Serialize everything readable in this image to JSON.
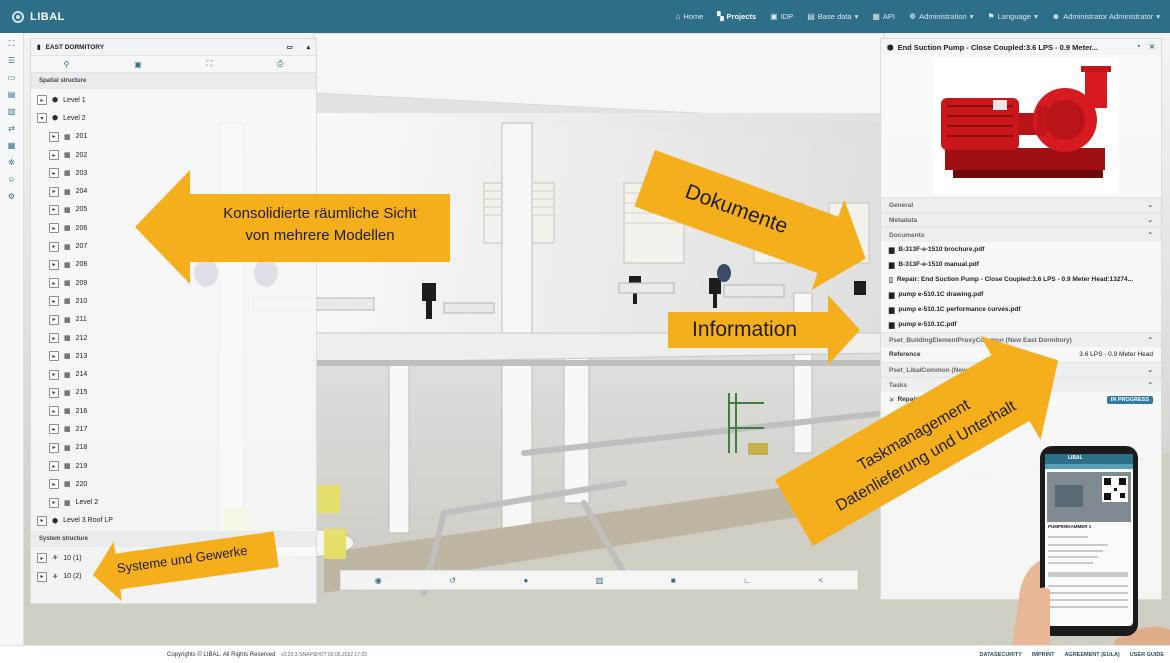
{
  "app": {
    "brand": "LIBAL",
    "nav": [
      {
        "icon": "home-icon",
        "glyph": "⌂",
        "label": "Home",
        "caret": false
      },
      {
        "icon": "projects-icon",
        "glyph": "▚",
        "label": "Projects",
        "caret": false,
        "active": true
      },
      {
        "icon": "idp-icon",
        "glyph": "▣",
        "label": "IDP",
        "caret": false
      },
      {
        "icon": "database-icon",
        "glyph": "▤",
        "label": "Base data",
        "caret": true
      },
      {
        "icon": "api-icon",
        "glyph": "▦",
        "label": "API",
        "caret": false
      },
      {
        "icon": "admin-icon",
        "glyph": "☸",
        "label": "Administration",
        "caret": true
      },
      {
        "icon": "flag-icon",
        "glyph": "⚑",
        "label": "Language",
        "caret": true
      },
      {
        "icon": "user-icon",
        "glyph": "☻",
        "label": "Administrator Administrator",
        "caret": true
      }
    ]
  },
  "left_panel": {
    "title": "EAST DORMITORY",
    "section_spatial": "Spatial structure",
    "tree": [
      {
        "label": "Level 1",
        "indent": 0,
        "btn": "▸",
        "icon": "layers-icon"
      },
      {
        "label": "Level 2",
        "indent": 0,
        "btn": "▾",
        "icon": "layers-icon"
      },
      {
        "label": "201",
        "indent": 1,
        "btn": "▸",
        "icon": "rooms-icon"
      },
      {
        "label": "202",
        "indent": 1,
        "btn": "▸",
        "icon": "rooms-icon"
      },
      {
        "label": "203",
        "indent": 1,
        "btn": "▸",
        "icon": "rooms-icon"
      },
      {
        "label": "204",
        "indent": 1,
        "btn": "▸",
        "icon": "rooms-icon"
      },
      {
        "label": "205",
        "indent": 1,
        "btn": "▸",
        "icon": "rooms-icon"
      },
      {
        "label": "206",
        "indent": 1,
        "btn": "▸",
        "icon": "rooms-icon"
      },
      {
        "label": "207",
        "indent": 1,
        "btn": "▸",
        "icon": "rooms-icon"
      },
      {
        "label": "208",
        "indent": 1,
        "btn": "▸",
        "icon": "rooms-icon"
      },
      {
        "label": "209",
        "indent": 1,
        "btn": "▸",
        "icon": "rooms-icon"
      },
      {
        "label": "210",
        "indent": 1,
        "btn": "▸",
        "icon": "rooms-icon"
      },
      {
        "label": "211",
        "indent": 1,
        "btn": "▸",
        "icon": "rooms-icon"
      },
      {
        "label": "212",
        "indent": 1,
        "btn": "▸",
        "icon": "rooms-icon"
      },
      {
        "label": "213",
        "indent": 1,
        "btn": "▸",
        "icon": "rooms-icon"
      },
      {
        "label": "214",
        "indent": 1,
        "btn": "▸",
        "icon": "rooms-icon"
      },
      {
        "label": "215",
        "indent": 1,
        "btn": "▸",
        "icon": "rooms-icon"
      },
      {
        "label": "216",
        "indent": 1,
        "btn": "▸",
        "icon": "rooms-icon"
      },
      {
        "label": "217",
        "indent": 1,
        "btn": "▸",
        "icon": "rooms-icon"
      },
      {
        "label": "218",
        "indent": 1,
        "btn": "▸",
        "icon": "rooms-icon"
      },
      {
        "label": "219",
        "indent": 1,
        "btn": "▸",
        "icon": "rooms-icon"
      },
      {
        "label": "220",
        "indent": 1,
        "btn": "▸",
        "icon": "rooms-icon"
      },
      {
        "label": "Level 2",
        "indent": 1,
        "btn": "▸",
        "icon": "rooms-icon"
      },
      {
        "label": "Level 3 Roof LP",
        "indent": 0,
        "btn": "▸",
        "icon": "layers-icon"
      }
    ],
    "section_system": "System structure",
    "system_tree": [
      {
        "label": "10 (1)",
        "icon": "network-icon"
      },
      {
        "label": "10 (2)",
        "icon": "network-icon"
      }
    ]
  },
  "right_panel": {
    "title": "End Suction Pump - Close Coupled:3.6 LPS - 0.9 Meter...",
    "sections": {
      "general": "General",
      "metadata": "Metadata",
      "documents": "Documents",
      "pset_proxy": "Pset_BuildingElementProxyCommon (New East Dormitory)",
      "pset_libal": "Pset_LibalCommon (New East Dormitory)",
      "tasks": "Tasks"
    },
    "documents": [
      {
        "name": "B-313F-e-1510 brochure.pdf",
        "icon": "pdf-icon",
        "glyph": "▆"
      },
      {
        "name": "B-313F-e-1510 manual.pdf",
        "icon": "pdf-icon",
        "glyph": "▆"
      },
      {
        "name": "Repair: End Suction Pump - Close Coupled:3.6 LPS - 0.9 Meter Head:13274...",
        "icon": "file-icon",
        "glyph": "▯"
      },
      {
        "name": "pump e-510.1C drawing.pdf",
        "icon": "pdf-icon",
        "glyph": "▆"
      },
      {
        "name": "pump e-510.1C performance curves.pdf",
        "icon": "pdf-icon",
        "glyph": "▆"
      },
      {
        "name": "pump e-510.1C.pdf",
        "icon": "pdf-icon",
        "glyph": "▆"
      }
    ],
    "reference_key": "Reference",
    "reference_value": "3.6 LPS - 0.9 Meter Head",
    "task_name": "Repair: End Suction Pump",
    "task_status": "IN PROGRESS"
  },
  "annotations": {
    "consolidated_l1": "Konsolidierte räumliche Sicht",
    "consolidated_l2": "von mehrere Modellen",
    "dokumente": "Dokumente",
    "information": "Information",
    "task_l1": "Taskmanagement",
    "task_l2": "Datenlieferung und Unterhalt",
    "systeme": "Systeme und Gewerke"
  },
  "mobile": {
    "app_name": "LIBAL",
    "caption": "PUMPENKAMMER 1"
  },
  "footer": {
    "copyright": "Copyrights © LIBAL. All Rights Reserved",
    "version": "v2.20.3-SNAPSHOT 03.06.2022 17:23",
    "links": [
      "DATASECURITY",
      "IMPRINT",
      "AGREEMENT (EULA)",
      "USER GUIDE"
    ]
  },
  "colors": {
    "topbar": "#2d6e88",
    "accent_arrow": "#f5ae1c",
    "badge": "#2d7ea0"
  }
}
